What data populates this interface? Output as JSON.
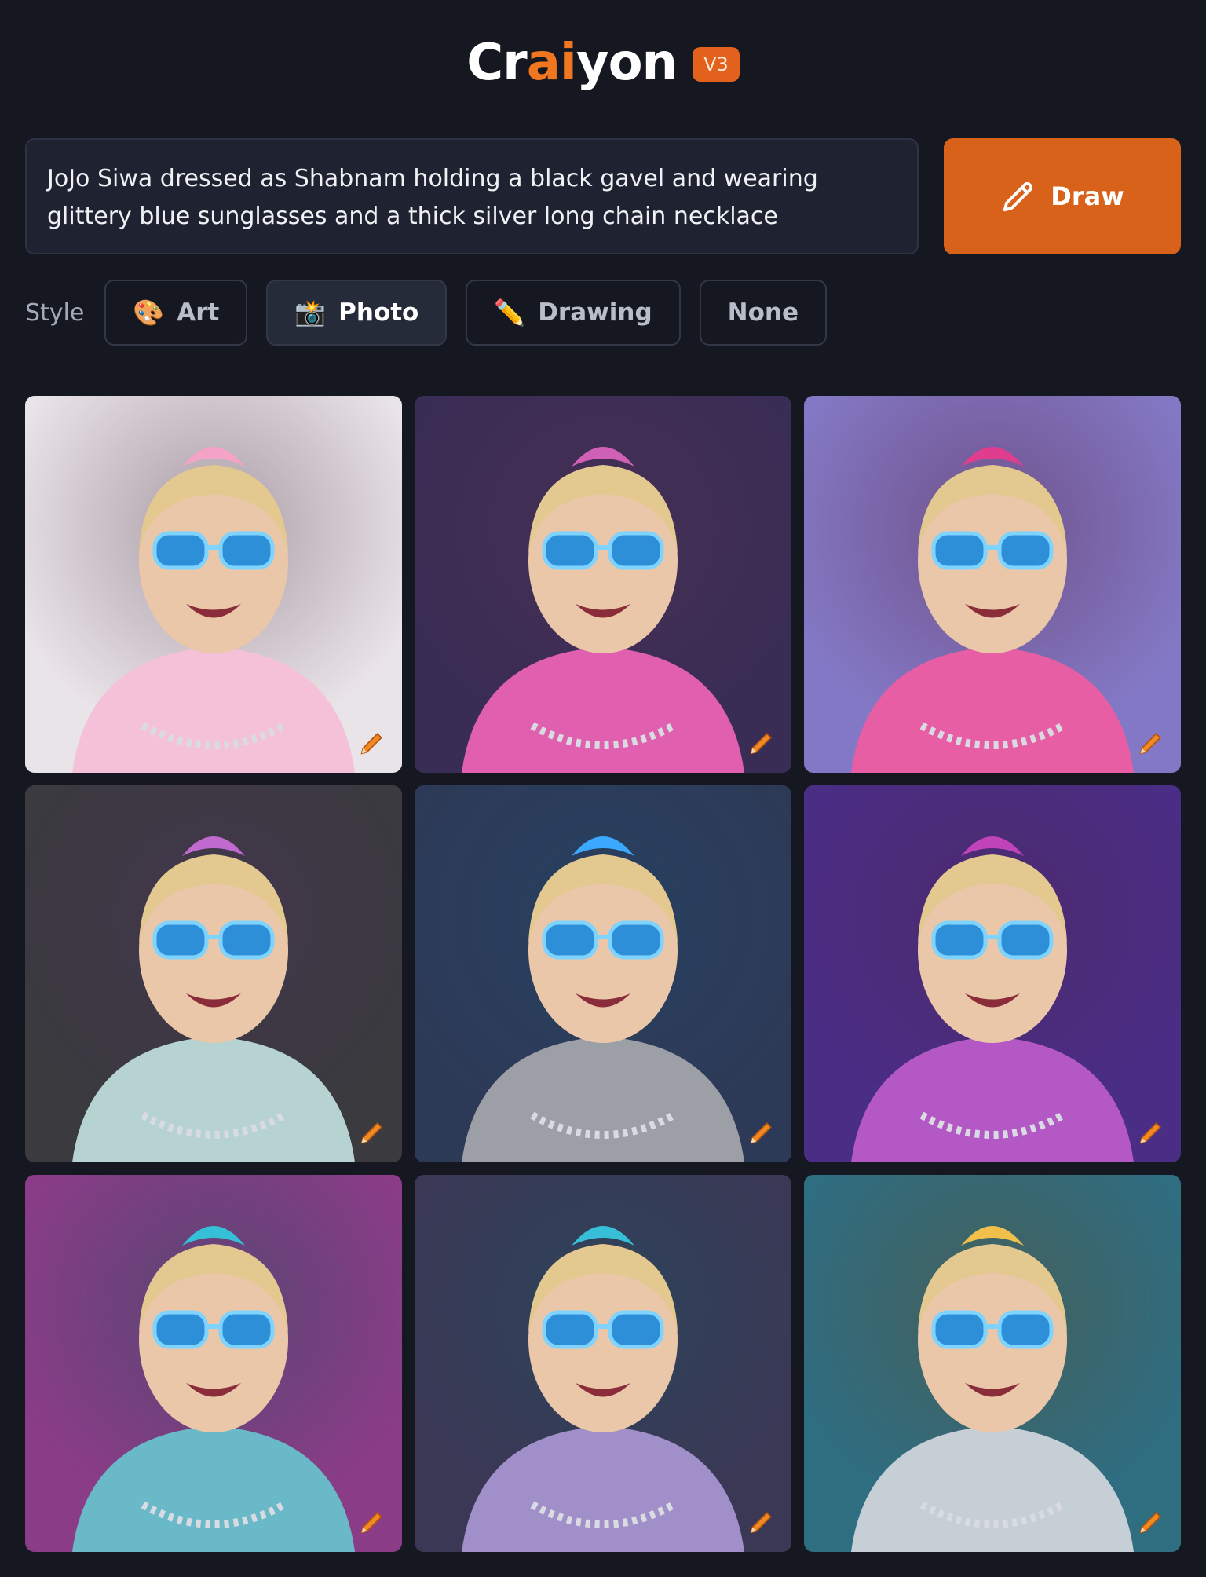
{
  "header": {
    "logo_parts": [
      "Cr",
      "ai",
      "yon"
    ],
    "version": "V3"
  },
  "prompt": {
    "text": "JoJo Siwa dressed as Shabnam holding a black gavel and wearing glittery blue sunglasses and a thick silver long chain necklace"
  },
  "draw_button": {
    "label": "Draw",
    "icon": "pencil-icon"
  },
  "style": {
    "label": "Style",
    "options": [
      {
        "label": "Art",
        "icon": "🎨",
        "active": false
      },
      {
        "label": "Photo",
        "icon": "📸",
        "active": true
      },
      {
        "label": "Drawing",
        "icon": "✏️",
        "active": false
      },
      {
        "label": "None",
        "icon": "",
        "active": false
      }
    ]
  },
  "results": {
    "count": 9,
    "tiles": [
      {
        "bg": "#e9e4e7",
        "accent": "#f2a3c6",
        "shirt": "#f5c1d9"
      },
      {
        "bg": "#3a2d55",
        "accent": "#d060b5",
        "shirt": "#e05fae"
      },
      {
        "bg": "#8479c5",
        "accent": "#e03d8f",
        "shirt": "#e85ea5"
      },
      {
        "bg": "#3a3a3f",
        "accent": "#c06ad0",
        "shirt": "#b6d2d1"
      },
      {
        "bg": "#2d3a58",
        "accent": "#3aa9ff",
        "shirt": "#9d9fa6"
      },
      {
        "bg": "#4b2e85",
        "accent": "#c044b8",
        "shirt": "#b458c6"
      },
      {
        "bg": "#8a3d87",
        "accent": "#35c0d8",
        "shirt": "#6ab9c9"
      },
      {
        "bg": "#3a3856",
        "accent": "#38bfd8",
        "shirt": "#a08fc8"
      },
      {
        "bg": "#2f6e82",
        "accent": "#f0c04a",
        "shirt": "#c7cfd6"
      }
    ]
  }
}
